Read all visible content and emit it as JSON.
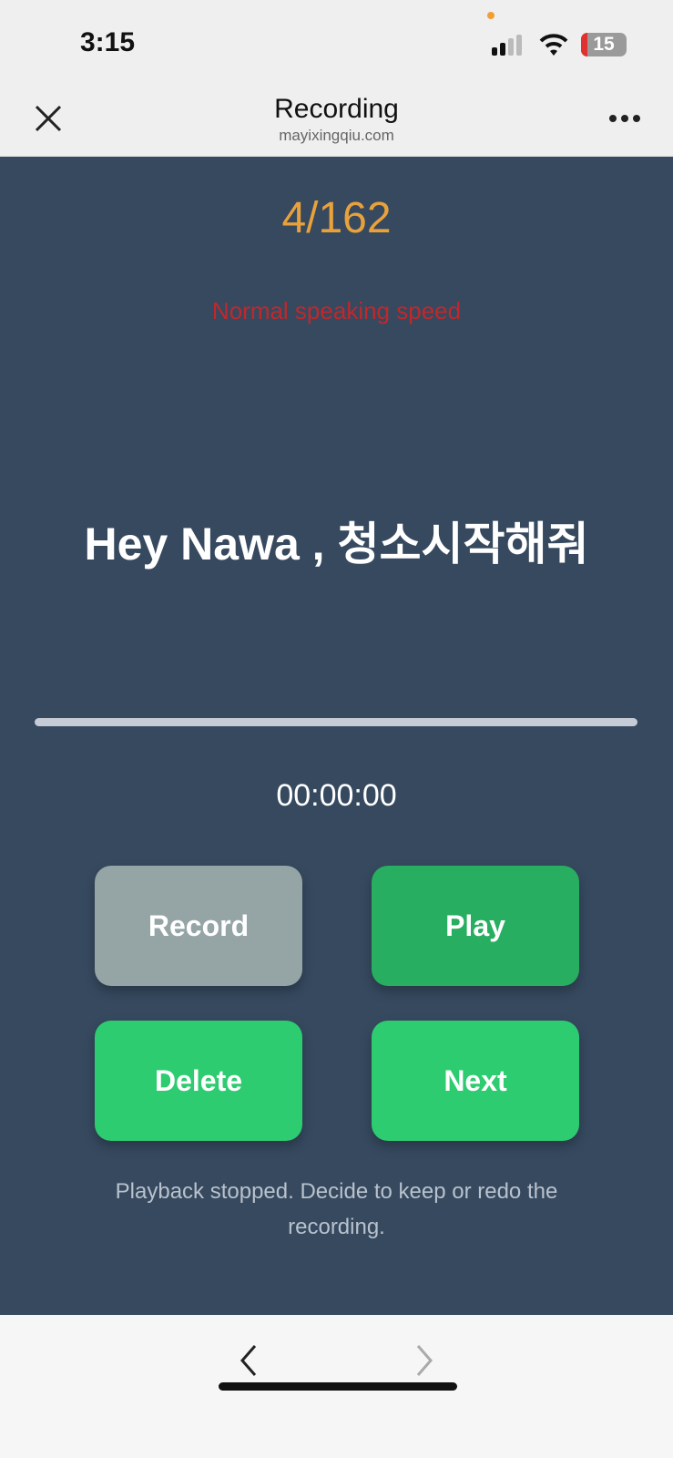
{
  "status_bar": {
    "time": "3:15",
    "battery": "15"
  },
  "header": {
    "title": "Recording",
    "domain": "mayixingqiu.com",
    "close_icon": "close-icon",
    "more_icon": "more-icon"
  },
  "main": {
    "counter": "4/162",
    "speed_hint": "Normal speaking speed",
    "phrase": "Hey Nawa , 청소시작해줘",
    "progress": 0,
    "timer": "00:00:00",
    "buttons": {
      "record": "Record",
      "play": "Play",
      "delete": "Delete",
      "next": "Next"
    },
    "status_message": "Playback stopped. Decide to keep or redo the recording."
  },
  "colors": {
    "background": "#36495f",
    "accent": "#e9a23b",
    "record_disabled": "#95a5a6",
    "play": "#27ae60",
    "green": "#2ecc71",
    "hint": "#c0282b"
  },
  "bottom_nav": {
    "back_icon": "chevron-left-icon",
    "forward_icon": "chevron-right-icon"
  }
}
